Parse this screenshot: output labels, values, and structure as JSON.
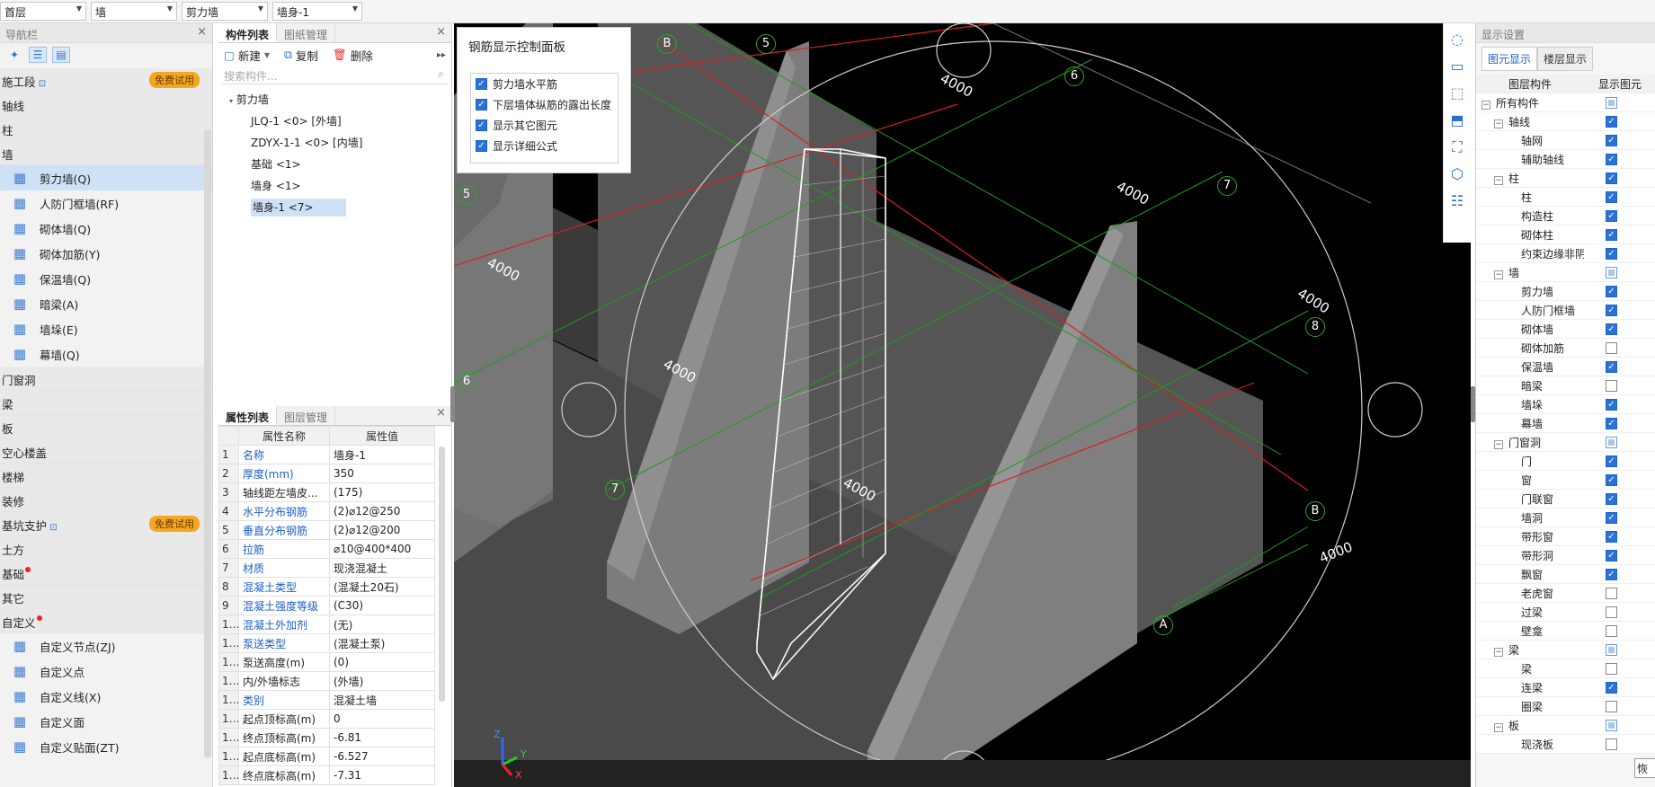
{
  "topbar": {
    "combos": [
      "首层",
      "墙",
      "剪力墙",
      "墙身-1"
    ]
  },
  "nav": {
    "title": "导航栏",
    "categories": [
      {
        "label": "施工段",
        "badge": "免费试用",
        "lock": true
      },
      {
        "label": "轴线"
      },
      {
        "label": "柱"
      },
      {
        "label": "墙",
        "children": [
          {
            "label": "剪力墙(Q)",
            "icon": "shear-wall-icon",
            "selected": true
          },
          {
            "label": "人防门框墙(RF)",
            "icon": "door-frame-wall-icon"
          },
          {
            "label": "砌体墙(Q)",
            "icon": "masonry-wall-icon"
          },
          {
            "label": "砌体加筋(Y)",
            "icon": "masonry-rebar-icon"
          },
          {
            "label": "保温墙(Q)",
            "icon": "insulation-wall-icon"
          },
          {
            "label": "暗梁(A)",
            "icon": "hidden-beam-icon"
          },
          {
            "label": "墙垛(E)",
            "icon": "wall-pier-icon"
          },
          {
            "label": "幕墙(Q)",
            "icon": "curtain-wall-icon"
          }
        ]
      },
      {
        "label": "门窗洞"
      },
      {
        "label": "梁"
      },
      {
        "label": "板"
      },
      {
        "label": "空心楼盖"
      },
      {
        "label": "楼梯"
      },
      {
        "label": "装修"
      },
      {
        "label": "基坑支护",
        "badge": "免费试用",
        "lock": true
      },
      {
        "label": "土方"
      },
      {
        "label": "基础",
        "dot": true
      },
      {
        "label": "其它"
      },
      {
        "label": "自定义",
        "dot": true,
        "children": [
          {
            "label": "自定义节点(ZJ)",
            "icon": "custom-node-icon",
            "dot": true
          },
          {
            "label": "自定义点",
            "icon": "custom-point-icon"
          },
          {
            "label": "自定义线(X)",
            "icon": "custom-line-icon"
          },
          {
            "label": "自定义面",
            "icon": "custom-face-icon"
          },
          {
            "label": "自定义贴面(ZT)",
            "icon": "custom-veneer-icon"
          }
        ]
      }
    ]
  },
  "components": {
    "tabs": [
      "构件列表",
      "图纸管理"
    ],
    "toolbar": {
      "new": "新建",
      "copy": "复制",
      "delete": "删除"
    },
    "search_placeholder": "搜索构件...",
    "tree_root": "剪力墙",
    "items": [
      {
        "label": "JLQ-1 <0> [外墙]"
      },
      {
        "label": "ZDYX-1-1 <0> [内墙]"
      },
      {
        "label": "基础 <1>"
      },
      {
        "label": "墙身 <1>"
      },
      {
        "label": "墙身-1 <7>",
        "selected": true
      }
    ]
  },
  "properties": {
    "tabs": [
      "属性列表",
      "图层管理"
    ],
    "headers": [
      "属性名称",
      "属性值"
    ],
    "rows": [
      {
        "n": "1",
        "name": "名称",
        "value": "墙身-1",
        "blue": true
      },
      {
        "n": "2",
        "name": "厚度(mm)",
        "value": "350",
        "blue": true
      },
      {
        "n": "3",
        "name": "轴线距左墙皮...",
        "value": "(175)",
        "blue": false
      },
      {
        "n": "4",
        "name": "水平分布钢筋",
        "value": "(2)⌀12@250",
        "blue": true
      },
      {
        "n": "5",
        "name": "垂直分布钢筋",
        "value": "(2)⌀12@200",
        "blue": true
      },
      {
        "n": "6",
        "name": "拉筋",
        "value": "⌀10@400*400",
        "blue": true
      },
      {
        "n": "7",
        "name": "材质",
        "value": "现浇混凝土",
        "blue": true
      },
      {
        "n": "8",
        "name": "混凝土类型",
        "value": "(混凝土20石)",
        "blue": true
      },
      {
        "n": "9",
        "name": "混凝土强度等级",
        "value": "(C30)",
        "blue": true
      },
      {
        "n": "10",
        "name": "混凝土外加剂",
        "value": "(无)",
        "blue": true
      },
      {
        "n": "11",
        "name": "泵送类型",
        "value": "(混凝土泵)",
        "blue": true
      },
      {
        "n": "12",
        "name": "泵送高度(m)",
        "value": "(0)",
        "blue": false
      },
      {
        "n": "13",
        "name": "内/外墙标志",
        "value": "(外墙)",
        "blue": false
      },
      {
        "n": "14",
        "name": "类别",
        "value": "混凝土墙",
        "blue": true
      },
      {
        "n": "15",
        "name": "起点顶标高(m)",
        "value": "0",
        "blue": false
      },
      {
        "n": "16",
        "name": "终点顶标高(m)",
        "value": "-6.81",
        "blue": false
      },
      {
        "n": "17",
        "name": "起点底标高(m)",
        "value": "-6.527",
        "blue": false
      },
      {
        "n": "18",
        "name": "终点底标高(m)",
        "value": "-7.31",
        "blue": false
      }
    ]
  },
  "rebar_panel": {
    "title": "钢筋显示控制面板",
    "options": [
      {
        "label": "剪力墙水平筋",
        "checked": true
      },
      {
        "label": "下层墙体纵筋的露出长度",
        "checked": true
      },
      {
        "label": "显示其它图元",
        "checked": true
      },
      {
        "label": "显示详细公式",
        "checked": true
      }
    ]
  },
  "viewport": {
    "axis_labels": [
      "B",
      "5",
      "6",
      "7",
      "8",
      "B",
      "A",
      "5",
      "6",
      "7",
      "8"
    ],
    "dimension": "4000",
    "triad": {
      "z": "Z",
      "y": "Y",
      "x": "X"
    }
  },
  "display": {
    "title": "显示设置",
    "tabs": [
      "图元显示",
      "楼层显示"
    ],
    "headers": [
      "图层构件",
      "显示图元"
    ],
    "rows": [
      {
        "label": "所有构件",
        "level": 0,
        "expand": "−",
        "state": "part"
      },
      {
        "label": "轴线",
        "level": 1,
        "expand": "−",
        "state": "on"
      },
      {
        "label": "轴网",
        "level": 2,
        "state": "on"
      },
      {
        "label": "辅助轴线",
        "level": 2,
        "state": "on"
      },
      {
        "label": "柱",
        "level": 1,
        "expand": "−",
        "state": "on"
      },
      {
        "label": "柱",
        "level": 2,
        "state": "on"
      },
      {
        "label": "构造柱",
        "level": 2,
        "state": "on"
      },
      {
        "label": "砌体柱",
        "level": 2,
        "state": "on"
      },
      {
        "label": "约束边缘非阴...",
        "level": 2,
        "state": "on"
      },
      {
        "label": "墙",
        "level": 1,
        "expand": "−",
        "state": "part"
      },
      {
        "label": "剪力墙",
        "level": 2,
        "state": "on"
      },
      {
        "label": "人防门框墙",
        "level": 2,
        "state": "on"
      },
      {
        "label": "砌体墙",
        "level": 2,
        "state": "on"
      },
      {
        "label": "砌体加筋",
        "level": 2,
        "state": "off"
      },
      {
        "label": "保温墙",
        "level": 2,
        "state": "on"
      },
      {
        "label": "暗梁",
        "level": 2,
        "state": "off"
      },
      {
        "label": "墙垛",
        "level": 2,
        "state": "on"
      },
      {
        "label": "幕墙",
        "level": 2,
        "state": "on"
      },
      {
        "label": "门窗洞",
        "level": 1,
        "expand": "−",
        "state": "part"
      },
      {
        "label": "门",
        "level": 2,
        "state": "on"
      },
      {
        "label": "窗",
        "level": 2,
        "state": "on"
      },
      {
        "label": "门联窗",
        "level": 2,
        "state": "on"
      },
      {
        "label": "墙洞",
        "level": 2,
        "state": "on"
      },
      {
        "label": "带形窗",
        "level": 2,
        "state": "on"
      },
      {
        "label": "带形洞",
        "level": 2,
        "state": "on"
      },
      {
        "label": "飘窗",
        "level": 2,
        "state": "on"
      },
      {
        "label": "老虎窗",
        "level": 2,
        "state": "off"
      },
      {
        "label": "过梁",
        "level": 2,
        "state": "off"
      },
      {
        "label": "壁龛",
        "level": 2,
        "state": "off"
      },
      {
        "label": "梁",
        "level": 1,
        "expand": "−",
        "state": "part"
      },
      {
        "label": "梁",
        "level": 2,
        "state": "off"
      },
      {
        "label": "连梁",
        "level": 2,
        "state": "on"
      },
      {
        "label": "圈梁",
        "level": 2,
        "state": "off"
      },
      {
        "label": "板",
        "level": 1,
        "expand": "−",
        "state": "part"
      },
      {
        "label": "现浇板",
        "level": 2,
        "state": "off"
      }
    ],
    "footer_button": "恢"
  }
}
